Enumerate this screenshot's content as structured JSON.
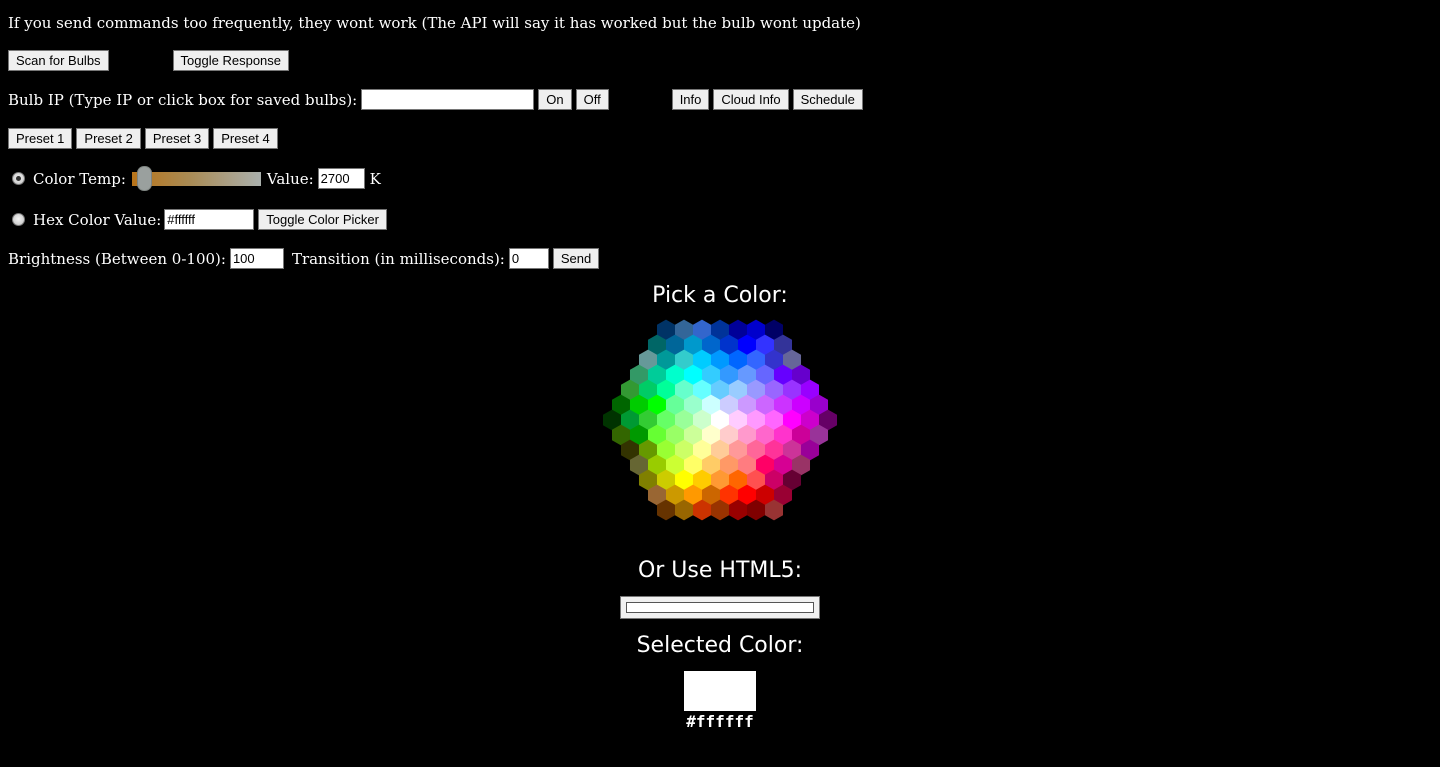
{
  "warning": "If you send commands too frequently, they wont work (The API will say it has worked but the bulb wont update)",
  "toolbar": {
    "scan_label": "Scan for Bulbs",
    "toggle_response_label": "Toggle Response"
  },
  "bulb": {
    "ip_label": "Bulb IP (Type IP or click box for saved bulbs):",
    "ip_value": "",
    "on_label": "On",
    "off_label": "Off",
    "info_label": "Info",
    "cloud_info_label": "Cloud Info",
    "schedule_label": "Schedule"
  },
  "presets": [
    "Preset 1",
    "Preset 2",
    "Preset 3",
    "Preset 4"
  ],
  "color_temp": {
    "label": "Color Temp:",
    "selected": true,
    "slider_fraction": 0.0,
    "value_label": "Value:",
    "value": "2700",
    "unit": "K"
  },
  "hex_color": {
    "label": "Hex Color Value:",
    "selected": false,
    "value": "#ffffff",
    "toggle_label": "Toggle Color Picker"
  },
  "brightness": {
    "label": "Brightness (Between 0-100):",
    "value": "100",
    "transition_label": "Transition (in milliseconds):",
    "transition_value": "0",
    "send_label": "Send"
  },
  "picker": {
    "title": "Pick a Color:",
    "html5_title": "Or Use HTML5:",
    "selected_title": "Selected Color:",
    "selected_value": "#ffffff",
    "html5_value": "#ffffff"
  },
  "hex_grid_rows": [
    [
      "#003366",
      "#336699",
      "#3366CC",
      "#003399",
      "#000099",
      "#0000CC",
      "#000066"
    ],
    [
      "#006666",
      "#006699",
      "#0099CC",
      "#0066CC",
      "#0033CC",
      "#0000FF",
      "#3333FF",
      "#333399"
    ],
    [
      "#669999",
      "#009999",
      "#33CCCC",
      "#00CCFF",
      "#0099FF",
      "#0066FF",
      "#3366FF",
      "#3333CC",
      "#666699"
    ],
    [
      "#339966",
      "#00CC99",
      "#00FFCC",
      "#00FFFF",
      "#33CCFF",
      "#3399FF",
      "#6699FF",
      "#6666FF",
      "#6600FF",
      "#6600CC"
    ],
    [
      "#339933",
      "#00CC66",
      "#00FF99",
      "#66FFCC",
      "#66FFFF",
      "#66CCFF",
      "#99CCFF",
      "#9999FF",
      "#9966FF",
      "#9933FF",
      "#9900FF"
    ],
    [
      "#006600",
      "#00CC00",
      "#00FF00",
      "#66FF99",
      "#99FFCC",
      "#CCFFFF",
      "#CCCCFF",
      "#CC99FF",
      "#CC66FF",
      "#CC33FF",
      "#CC00FF",
      "#9900CC"
    ],
    [
      "#003300",
      "#009933",
      "#33CC33",
      "#66FF66",
      "#99FF99",
      "#CCFFCC",
      "#FFFFFF",
      "#FFCCFF",
      "#FF99FF",
      "#FF66FF",
      "#FF00FF",
      "#CC00CC",
      "#660066"
    ],
    [
      "#336600",
      "#009900",
      "#66FF33",
      "#99FF66",
      "#CCFF99",
      "#FFFFCC",
      "#FFCCCC",
      "#FF99CC",
      "#FF66CC",
      "#FF33CC",
      "#CC0099",
      "#993399"
    ],
    [
      "#333300",
      "#669900",
      "#99FF33",
      "#CCFF66",
      "#FFFF99",
      "#FFCC99",
      "#FF9999",
      "#FF6699",
      "#FF3399",
      "#CC3399",
      "#990099"
    ],
    [
      "#666633",
      "#99CC00",
      "#CCFF33",
      "#FFFF66",
      "#FFCC66",
      "#FF9966",
      "#FF7C80",
      "#FF0066",
      "#D60093",
      "#993366"
    ],
    [
      "#808000",
      "#CCCC00",
      "#FFFF00",
      "#FFCC00",
      "#FF9933",
      "#FF6600",
      "#FF5050",
      "#CC0066",
      "#660033"
    ],
    [
      "#996633",
      "#CC9900",
      "#FF9900",
      "#CC6600",
      "#FF3300",
      "#FF0000",
      "#CC0000",
      "#990033"
    ],
    [
      "#663300",
      "#996600",
      "#CC3300",
      "#993300",
      "#990000",
      "#800000",
      "#993333"
    ]
  ]
}
